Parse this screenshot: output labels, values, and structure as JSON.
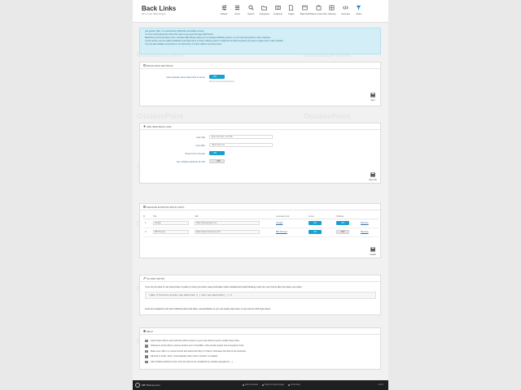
{
  "app": {
    "title": "Back Links",
    "subtitle": "All In One SEO Plugin"
  },
  "nav": [
    {
      "label": "Default",
      "icon": "settings-sliders-icon"
    },
    {
      "label": "Items",
      "icon": "list-icon"
    },
    {
      "label": "Search",
      "icon": "search-icon"
    },
    {
      "label": "Categories",
      "icon": "folder-icon"
    },
    {
      "label": "Locations",
      "icon": "map-marker-icon"
    },
    {
      "label": "Pages",
      "icon": "page-icon"
    },
    {
      "label": "Back links",
      "icon": "link-icon"
    },
    {
      "label": "Places Local Links",
      "icon": "building-icon"
    },
    {
      "label": "Sitemap",
      "icon": "sitemap-icon"
    },
    {
      "label": "Overview",
      "icon": "code-icon"
    },
    {
      "label": "Filters",
      "icon": "filter-icon"
    }
  ],
  "info_lines": [
    "Get greater SEO, it is assumed by Backlinks and alikes service.",
    "You are exchanging links with other sites to get good off page SEO factor.",
    "Backlinks (Incoming links) of off + Osclass SEO Plugin helps you to manage backlinks shown on your site that points to other websites.",
    "In this section you can define backlinks and show them in footer without need to modify theme files anywhere you want to place link to other website.",
    "You can also disable some links to not show them in footer without removing them."
  ],
  "backlinks_settings": {
    "heading": "BACKLINKS SETTINGS",
    "field_label": "Automatically show back links in footer",
    "toggle": "ON",
    "hint": "Show footer via hook (footer)",
    "save": "Save"
  },
  "add_new": {
    "heading": "ADD NEW BACK LINK",
    "fields": [
      {
        "label": "Link Title",
        "placeholder": "Enter text here, min 200"
      },
      {
        "label": "Link URL",
        "placeholder": "https://site.com"
      }
    ],
    "show_label": "Show Link in Footer",
    "show_toggle": "ON",
    "nofollow_label": "Set nofollow attribute for link",
    "nofollow_toggle": "OFF",
    "save": "Save link"
  },
  "manage": {
    "heading": "MANAGE EXISTING BACK LINKS",
    "columns": [
      "ID",
      "Title",
      "URL",
      "Generated Link",
      "Footer",
      "Nofollow",
      ""
    ],
    "rows": [
      {
        "id": "1",
        "title": "Google",
        "url": "https://www.google.com",
        "generated": "Google",
        "footer": "ON",
        "nofollow": "ON",
        "action": "Remove"
      },
      {
        "id": "2",
        "title": "MB Themes",
        "url": "https://www.mb-themes.com",
        "generated": "MB Themes",
        "footer": "ON",
        "nofollow": "OFF",
        "action": "Remove"
      }
    ],
    "save": "Update"
  },
  "plugin_setup": {
    "heading": "PLUGIN SETUP",
    "text1": "If you do not want to use hook footer to place to show your links, keep Automatic option disabled and add following code into your theme files into place you prefer:",
    "code": "<?php if(function_exists('seo_backlinks')) { echo seo_backlinks(); } ?>",
    "text2": "Links are wrapped in div with id #footer-links and class .seo-backlinks so you can easily style them in your theme CSS style sheet."
  },
  "help": {
    "heading": "HELP",
    "items": [
      "Hook footer will be used and links will be shown on your site without need to modify theme files.",
      "Title/name of link will be used as anchor text in frontoffice. Title should contain some keyword of site.",
      "Make sure URL is in correct format and starts with http:// or https:// otherwise link will not be functional.",
      "Add link to footer, when \"Automatically show Links in Footer\" is enabled.",
      "Add nofollow attribute to link, then link will not be considered by crawlers (google bot ...)."
    ]
  },
  "footer": {
    "brand": "MB Themes.com",
    "links": [
      "Docs & Guides",
      "Plugin & Support page",
      "Community"
    ],
    "version": "v1.0.0"
  },
  "watermark": "OsclassPoint"
}
